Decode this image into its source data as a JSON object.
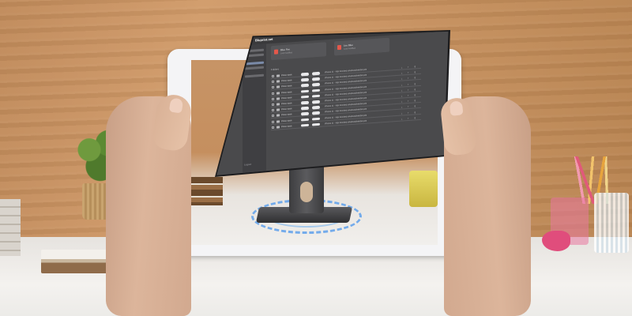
{
  "scene": {
    "description_elements": [
      "wall",
      "desk",
      "plant",
      "books",
      "pencil-cup",
      "tablet",
      "monitor",
      "ar-ring"
    ],
    "colors": {
      "wall": "#c99263",
      "desk": "#f1efec",
      "tablet_frame": "#f4f4f6",
      "monitor_body": "#1c1c1e",
      "app_background": "#4a4a4c",
      "ar_ring": "#5ea0eb",
      "accent_red": "#e4584b"
    }
  },
  "app": {
    "brand": "Bluprint.net",
    "user": "Robert Richardson",
    "cards": [
      {
        "title": "Blue Fire",
        "subtitle": "Last modified"
      },
      {
        "title": "Leo Blue",
        "subtitle": "Last modified"
      }
    ],
    "table_header": "Folders",
    "rows": [
      {
        "name": "Photo stack",
        "url": "iPhone 11 - http://embed.io/upload/trak/bicycle"
      },
      {
        "name": "Photo stack",
        "url": "iPhone 11 - http://embed.io/upload/trak/bicycle"
      },
      {
        "name": "Photo stack",
        "url": "iPhone 11 - http://embed.io/upload/trak/bicycle"
      },
      {
        "name": "Photo stack",
        "url": "iPhone 11 - http://embed.io/upload/trak/bicycle"
      },
      {
        "name": "Photo stack",
        "url": "iPhone 11 - http://embed.io/upload/trak/bicycle"
      },
      {
        "name": "Photo stack",
        "url": "iPhone 11 - http://embed.io/upload/trak/bicycle"
      },
      {
        "name": "Photo stack",
        "url": "iPhone 11 - http://embed.io/upload/trak/bicycle"
      },
      {
        "name": "Photo stack",
        "url": "iPhone 11 - http://embed.io/upload/trak/bicycle"
      },
      {
        "name": "Photo stack",
        "url": "iPhone 11 - http://embed.io/upload/trak/bicycle"
      },
      {
        "name": "Photo stack",
        "url": "iPhone 11 - http://embed.io/upload/trak/bicycle"
      }
    ],
    "footer": "Logout"
  }
}
